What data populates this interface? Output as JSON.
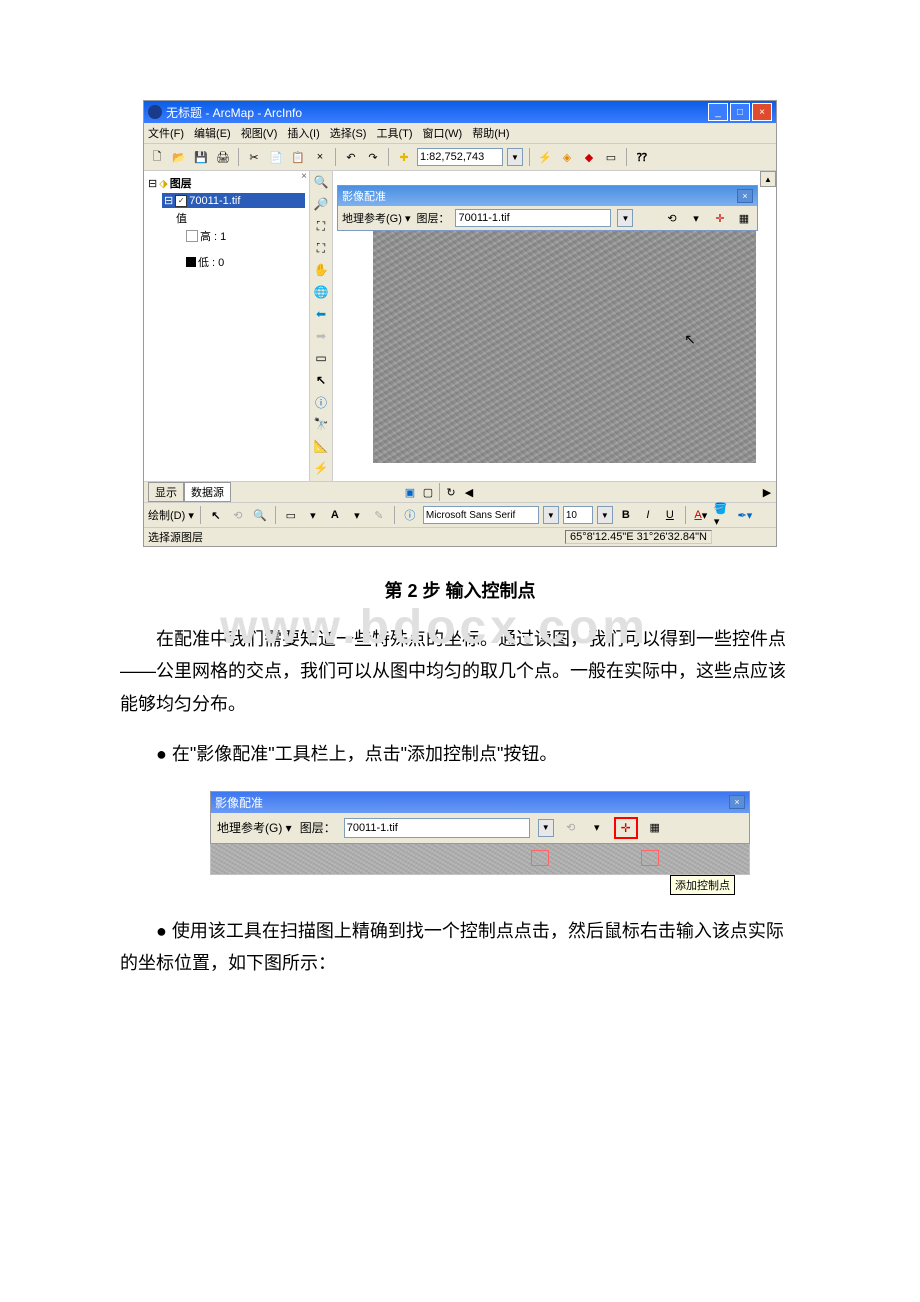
{
  "watermark": "www.bdocx.com",
  "app": {
    "title": "无标题 - ArcMap - ArcInfo",
    "menus": {
      "file": "文件(F)",
      "edit": "编辑(E)",
      "view": "视图(V)",
      "insert": "插入(I)",
      "select": "选择(S)",
      "tools": "工具(T)",
      "window": "窗口(W)",
      "help": "帮助(H)"
    },
    "toolbar": {
      "scale": "1:82,752,743"
    },
    "toc": {
      "close": "×",
      "root": "图层",
      "layer": "70011-1.tif",
      "value": "值",
      "high": "高 : 1",
      "low": "低 : 0"
    },
    "georef": {
      "title": "影像配准",
      "geoRef": "地理参考(G)",
      "layerLabel": "图层：",
      "layerValue": "70011-1.tif"
    },
    "bottom": {
      "show": "显示",
      "source": "数据源",
      "draw": "绘制(D)",
      "font": "Microsoft Sans Serif",
      "size": "10",
      "bold": "B",
      "italic": "I",
      "underline": "U"
    },
    "status": {
      "left": "选择源图层",
      "coord": "65°8'12.45\"E  31°26'32.84\"N"
    }
  },
  "body": {
    "stepTitle": "第 2 步 输入控制点",
    "para1": "在配准中我们需要知道一些特殊点的坐标。通过读图，我们可以得到一些控件点——公里网格的交点，我们可以从图中均匀的取几个点。一般在实际中，这些点应该能够均匀分布。",
    "bullet1": "● 在\"影像配准\"工具栏上，点击\"添加控制点\"按钮。",
    "tooltip": "添加控制点",
    "bullet2": "● 使用该工具在扫描图上精确到找一个控制点点击，然后鼠标右击输入该点实际的坐标位置，如下图所示："
  }
}
